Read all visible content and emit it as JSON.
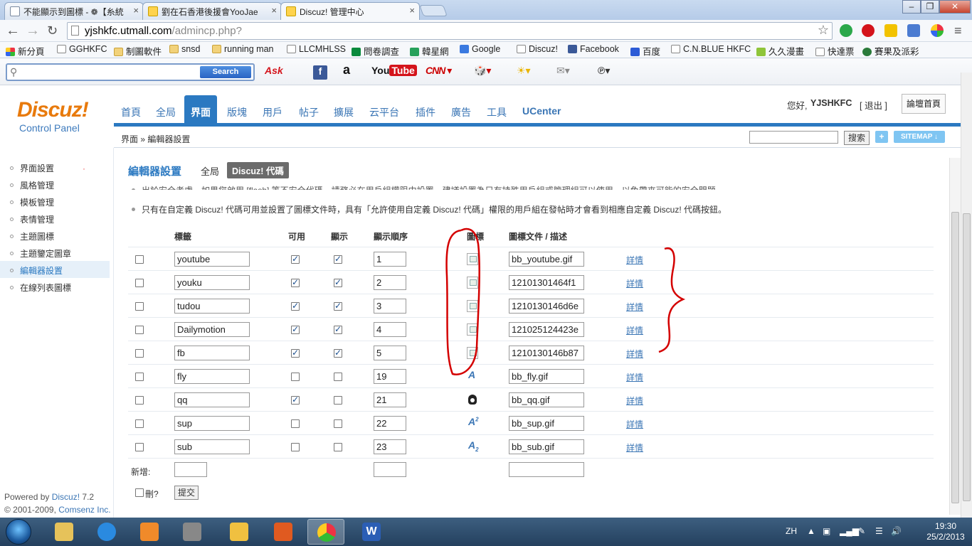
{
  "browser": {
    "tabs": [
      {
        "title": "不能顯示到圖標 - ❁【糸統",
        "active": false
      },
      {
        "title": "劉在石香港後援會YooJae",
        "active": false
      },
      {
        "title": "Discuz! 管理中心",
        "active": true
      }
    ],
    "url_host": "yjshkfc.utmall.com",
    "url_path": "/admincp.php?",
    "url": "yjshkfc.utmall.com/admincp.php?",
    "bookmarks": [
      "新分頁",
      "GGHKFC",
      "制圖軟件",
      "snsd",
      "running man",
      "LLCMHLSS",
      "問卷調查",
      "韓星網",
      "Google",
      "Discuz!",
      "Facebook",
      "百度",
      "C.N.BLUE HKFC",
      "久久漫畫",
      "快達票",
      "賽果及派彩"
    ],
    "ask_toolbar": {
      "search_placeholder": "",
      "search_button": "Search"
    }
  },
  "admin": {
    "logo_text": "Discuz!",
    "logo_sub": "Control Panel",
    "nav": [
      "首頁",
      "全局",
      "界面",
      "版塊",
      "用戶",
      "帖子",
      "擴展",
      "云平台",
      "插件",
      "廣告",
      "工具",
      "UCenter"
    ],
    "active_nav": "界面",
    "greeting": "您好,",
    "username": "YJSHKFC",
    "logout": "[ 退出 ]",
    "home_button": "論壇首頁",
    "breadcrumb": "界面 » 編輯器設置",
    "search_button": "搜索",
    "plus_button": "+",
    "sitemap_button": "SITEMAP ↓",
    "sidebar": [
      "界面設置",
      "風格管理",
      "模板管理",
      "表情管理",
      "主題圖標",
      "主題鑒定圖章",
      "編輯器設置",
      "在線列表圖標"
    ],
    "active_sidebar": "編輯器設置",
    "powered_prefix": "Powered by",
    "powered_brand": "Discuz!",
    "powered_version": "7.2",
    "copyright_prefix": "© 2001-2009,",
    "copyright_company": "Comsenz Inc."
  },
  "content": {
    "title": "編輯器設置",
    "subtab_global": "全局",
    "subtab_active": "Discuz! 代碼",
    "tip_cut": "出於安全考慮，如果您啟用 [flash] 等不安全代碼，請務必在用戶組權限中設置，建議設置為只有持殊用戶組或管理組可以使用，以免帶來可能的安全問題。",
    "tip": "只有在自定義 Discuz! 代碼可用並設置了圖標文件時，具有「允許使用自定義 Discuz! 代碼」權限的用戶組在發帖時才會看到相應自定義 Discuz! 代碼按鈕。",
    "headers": {
      "tag": "標籤",
      "enabled": "可用",
      "display": "顯示",
      "order": "顯示順序",
      "icon": "圖標",
      "iconfile": "圖標文件 / 描述"
    },
    "rows": [
      {
        "tag": "youtube",
        "enabled": true,
        "display": true,
        "order": "1",
        "icon": "broken-image",
        "iconfile": "bb_youtube.gif",
        "detail": "詳情"
      },
      {
        "tag": "youku",
        "enabled": true,
        "display": true,
        "order": "2",
        "icon": "broken-image",
        "iconfile": "12101301464f1",
        "detail": "詳情"
      },
      {
        "tag": "tudou",
        "enabled": true,
        "display": true,
        "order": "3",
        "icon": "broken-image",
        "iconfile": "1210130146d6e",
        "detail": "詳情"
      },
      {
        "tag": "Dailymotion",
        "enabled": true,
        "display": true,
        "order": "4",
        "icon": "broken-image",
        "iconfile": "121025124423e",
        "detail": "詳情"
      },
      {
        "tag": "fb",
        "enabled": true,
        "display": true,
        "order": "5",
        "icon": "broken-image",
        "iconfile": "1210130146b87",
        "detail": "詳情"
      },
      {
        "tag": "fly",
        "enabled": false,
        "display": false,
        "order": "19",
        "icon": "fly",
        "iconfile": "bb_fly.gif",
        "detail": "詳情"
      },
      {
        "tag": "qq",
        "enabled": true,
        "display": false,
        "order": "21",
        "icon": "qq",
        "iconfile": "bb_qq.gif",
        "detail": "詳情"
      },
      {
        "tag": "sup",
        "enabled": false,
        "display": false,
        "order": "22",
        "icon": "sup",
        "iconfile": "bb_sup.gif",
        "detail": "詳情"
      },
      {
        "tag": "sub",
        "enabled": false,
        "display": false,
        "order": "23",
        "icon": "sub",
        "iconfile": "bb_sub.gif",
        "detail": "詳情"
      }
    ],
    "new_label": "新增:",
    "delete_label": "刪?",
    "submit_label": "提交"
  },
  "taskbar": {
    "lang": "ZH",
    "time": "19:30",
    "date": "25/2/2013"
  },
  "colors": {
    "accent": "#2b79c1",
    "logo": "#e87a0c",
    "annotation": "#d40000"
  }
}
